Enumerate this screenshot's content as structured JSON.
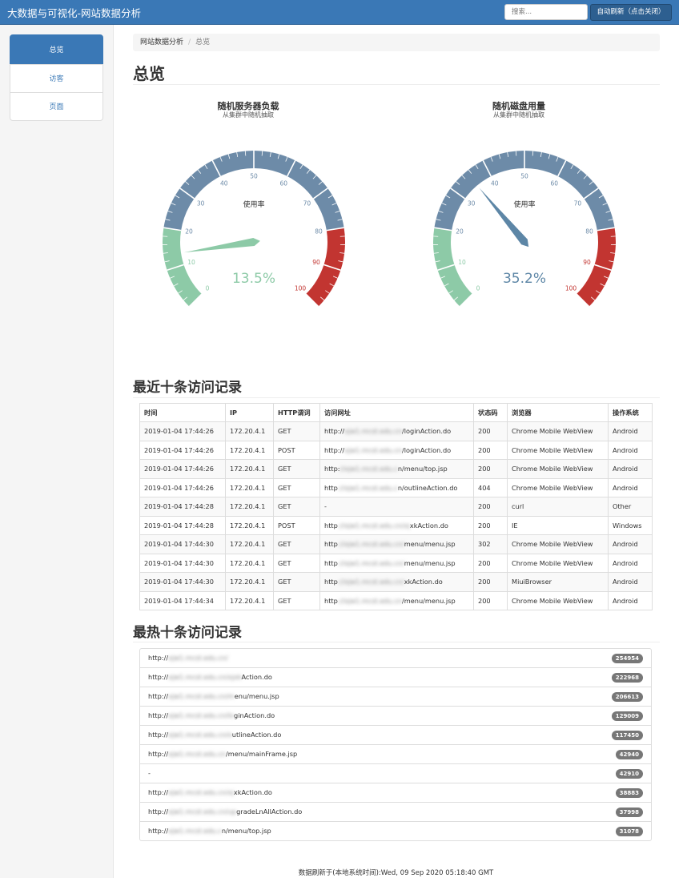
{
  "navbar": {
    "brand": "大数据与可视化-网站数据分析",
    "search_placeholder": "搜索...",
    "refresh_button": "自动刷新（点击关闭）"
  },
  "sidebar": {
    "items": [
      {
        "label": "总览",
        "active": true
      },
      {
        "label": "访客",
        "active": false
      },
      {
        "label": "页面",
        "active": false
      }
    ]
  },
  "breadcrumb": {
    "parent": "网站数据分析",
    "current": "总览"
  },
  "page_title": "总览",
  "gauges": [
    {
      "title": "随机服务器负载",
      "subtitle": "从集群中随机抽取",
      "center_label": "使用率",
      "value": 13.5,
      "value_text": "13.5%",
      "color": "#8dcaa7"
    },
    {
      "title": "随机磁盘用量",
      "subtitle": "从集群中随机抽取",
      "center_label": "使用率",
      "value": 35.2,
      "value_text": "35.2%",
      "color": "#5d86a6"
    }
  ],
  "gauge_ticks": [
    "0",
    "10",
    "20",
    "30",
    "40",
    "50",
    "60",
    "70",
    "80",
    "90",
    "100"
  ],
  "gauge_colors": {
    "low": "#8dcaa7",
    "mid": "#6d8ba8",
    "high": "#c23531"
  },
  "recent": {
    "title": "最近十条访问记录",
    "headers": [
      "时间",
      "IP",
      "HTTP谓词",
      "访问网址",
      "状态码",
      "浏览器",
      "操作系统"
    ],
    "rows": [
      {
        "time": "2019-01-04 17:44:26",
        "ip": "172.20.4.1",
        "verb": "GET",
        "url_visible": "http://",
        "url_blur": "xjw1.mcst.edu.cn",
        "url_tail": "/loginAction.do",
        "status": "200",
        "browser": "Chrome Mobile WebView",
        "os": "Android"
      },
      {
        "time": "2019-01-04 17:44:26",
        "ip": "172.20.4.1",
        "verb": "POST",
        "url_visible": "http://",
        "url_blur": "xjw1.mcst.edu.cn",
        "url_tail": "/loginAction.do",
        "status": "200",
        "browser": "Chrome Mobile WebView",
        "os": "Android"
      },
      {
        "time": "2019-01-04 17:44:26",
        "ip": "172.20.4.1",
        "verb": "GET",
        "url_visible": "http:",
        "url_blur": "//xjw1.mcst.edu.c",
        "url_tail": "n/menu/top.jsp",
        "status": "200",
        "browser": "Chrome Mobile WebView",
        "os": "Android"
      },
      {
        "time": "2019-01-04 17:44:26",
        "ip": "172.20.4.1",
        "verb": "GET",
        "url_visible": "http",
        "url_blur": "://xjw1.mcst.edu.c",
        "url_tail": "n/outlineAction.do",
        "status": "404",
        "browser": "Chrome Mobile WebView",
        "os": "Android"
      },
      {
        "time": "2019-01-04 17:44:28",
        "ip": "172.20.4.1",
        "verb": "GET",
        "url_visible": "-",
        "url_blur": "",
        "url_tail": "",
        "status": "200",
        "browser": "curl",
        "os": "Other"
      },
      {
        "time": "2019-01-04 17:44:28",
        "ip": "172.20.4.1",
        "verb": "POST",
        "url_visible": "http",
        "url_blur": "://xjw1.mcst.edu.cn/xj",
        "url_tail": "xkAction.do",
        "status": "200",
        "browser": "IE",
        "os": "Windows"
      },
      {
        "time": "2019-01-04 17:44:30",
        "ip": "172.20.4.1",
        "verb": "GET",
        "url_visible": "http",
        "url_blur": "://xjw1.mcst.edu.cn/",
        "url_tail": "menu/menu.jsp",
        "status": "302",
        "browser": "Chrome Mobile WebView",
        "os": "Android"
      },
      {
        "time": "2019-01-04 17:44:30",
        "ip": "172.20.4.1",
        "verb": "GET",
        "url_visible": "http",
        "url_blur": "://xjw1.mcst.edu.cn/",
        "url_tail": "menu/menu.jsp",
        "status": "200",
        "browser": "Chrome Mobile WebView",
        "os": "Android"
      },
      {
        "time": "2019-01-04 17:44:30",
        "ip": "172.20.4.1",
        "verb": "GET",
        "url_visible": "http",
        "url_blur": "://xjw1.mcst.edu.cn/",
        "url_tail": "xkAction.do",
        "status": "200",
        "browser": "MiuiBrowser",
        "os": "Android"
      },
      {
        "time": "2019-01-04 17:44:34",
        "ip": "172.20.4.1",
        "verb": "GET",
        "url_visible": "http",
        "url_blur": "://xjw1.mcst.edu.cn",
        "url_tail": "/menu/menu.jsp",
        "status": "200",
        "browser": "Chrome Mobile WebView",
        "os": "Android"
      }
    ]
  },
  "hot": {
    "title": "最热十条访问记录",
    "items": [
      {
        "url_visible": "http://",
        "url_blur": "xjw1.mcst.edu.cn/",
        "url_tail": "",
        "count": "254954"
      },
      {
        "url_visible": "http://",
        "url_blur": "xjw1.mcst.edu.cn/xjxk",
        "url_tail": "Action.do",
        "count": "222968"
      },
      {
        "url_visible": "http://",
        "url_blur": "xjw1.mcst.edu.cn/m",
        "url_tail": "enu/menu.jsp",
        "count": "206613"
      },
      {
        "url_visible": "http://",
        "url_blur": "xjw1.mcst.edu.cn/lo",
        "url_tail": "ginAction.do",
        "count": "129009"
      },
      {
        "url_visible": "http://",
        "url_blur": "xjw1.mcst.edu.cn/o",
        "url_tail": "utlineAction.do",
        "count": "117450"
      },
      {
        "url_visible": "http://",
        "url_blur": "xjw1.mcst.edu.cn",
        "url_tail": "/menu/mainFrame.jsp",
        "count": "42940"
      },
      {
        "url_visible": "-",
        "url_blur": "",
        "url_tail": "",
        "count": "42910"
      },
      {
        "url_visible": "http://",
        "url_blur": "xjw1.mcst.edu.cn/xj",
        "url_tail": "xkAction.do",
        "count": "38883"
      },
      {
        "url_visible": "http://",
        "url_blur": "xjw1.mcst.edu.cn/up",
        "url_tail": "gradeLnAllAction.do",
        "count": "37998"
      },
      {
        "url_visible": "http://",
        "url_blur": "xjw1.mcst.edu.c",
        "url_tail": "n/menu/top.jsp",
        "count": "31078"
      }
    ]
  },
  "footer": "数据刷新于(本地系统时间):Wed, 09 Sep 2020 05:18:40 GMT"
}
